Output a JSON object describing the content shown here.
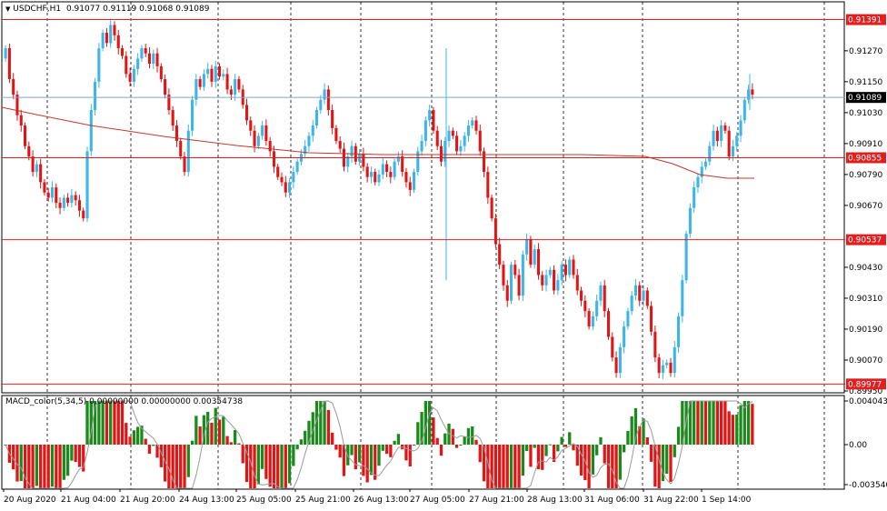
{
  "main_chart": {
    "symbol_timeframe": "USDCHF,H1",
    "ohlc": [
      "0.91077",
      "0.91119",
      "0.91068",
      "0.91089"
    ],
    "price_ticks": [
      "0.91270",
      "0.91150",
      "0.91030",
      "0.90910",
      "0.90790",
      "0.90670",
      "0.90430",
      "0.90310",
      "0.90190",
      "0.90070",
      "0.89950"
    ],
    "horizontal_lines": [
      {
        "label": "0.91391",
        "price": 0.91391
      },
      {
        "label": "0.90855",
        "price": 0.90855
      },
      {
        "label": "0.90537",
        "price": 0.90537
      },
      {
        "label": "0.89977",
        "price": 0.89977
      }
    ],
    "bid_line": {
      "label": "0.91089",
      "price": 0.91089
    },
    "colors": {
      "bull": "#3cb5e8",
      "bear": "#e01616",
      "level_line": "#e02020",
      "ma": "#c0392b",
      "bid_line": "#7fa7c9"
    }
  },
  "macd": {
    "label": "MACD_color(5,34,5) 0.00000000 0.00000000 0.00354738",
    "ticks": [
      "0.0040435",
      "0.00",
      "-0.0035407"
    ],
    "colors": {
      "up": "#1a8a1a",
      "down": "#e01616",
      "signal": "#9a9a9a"
    }
  },
  "time_axis": [
    "20 Aug 2020",
    "21 Aug 04:00",
    "21 Aug 20:00",
    "24 Aug 13:00",
    "25 Aug 05:00",
    "25 Aug 21:00",
    "26 Aug 13:00",
    "27 Aug 05:00",
    "27 Aug 21:00",
    "28 Aug 13:00",
    "31 Aug 06:00",
    "31 Aug 22:00",
    "1 Sep 14:00"
  ]
}
